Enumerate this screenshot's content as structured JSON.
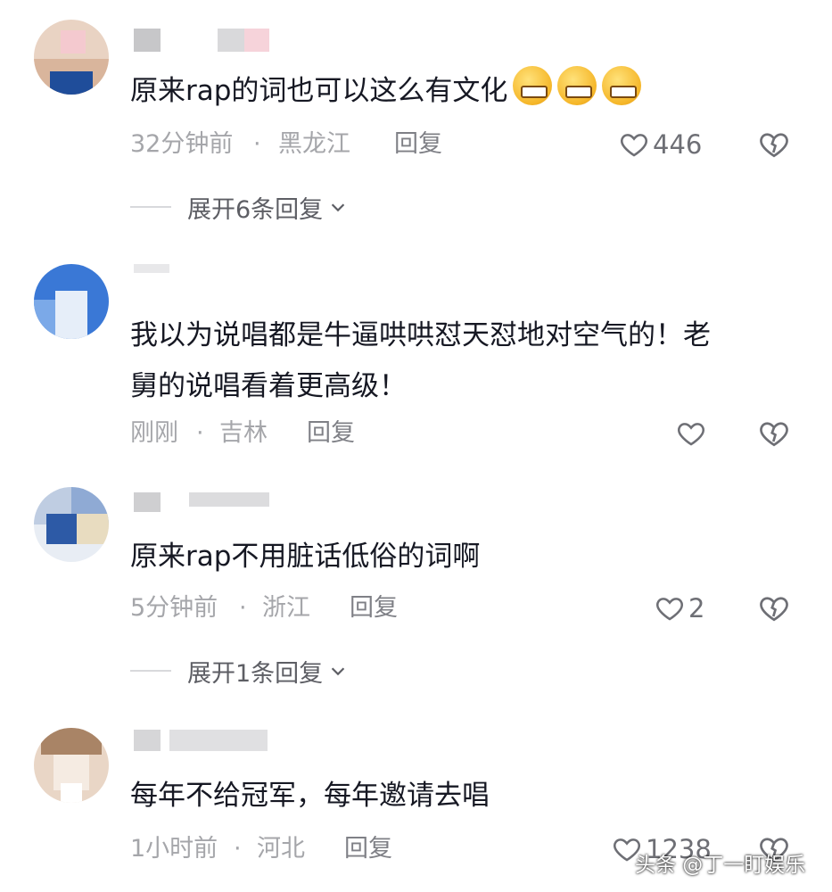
{
  "comments": [
    {
      "text": "原来rap的词也可以这么有文化",
      "emoji": "grinning-sweat-emoji",
      "time": "32分钟前",
      "separator": "·",
      "location": "黑龙江",
      "reply_label": "回复",
      "likes": "446",
      "expand_label": "展开6条回复"
    },
    {
      "text": "我以为说唱都是牛逼哄哄怼天怼地对空气的！老\n舅的说唱看着更高级！",
      "time": "刚刚",
      "separator": "·",
      "location": "吉林",
      "reply_label": "回复",
      "likes": ""
    },
    {
      "text": "原来rap不用脏话低俗的词啊",
      "time": "5分钟前",
      "separator": "·",
      "location": "浙江",
      "reply_label": "回复",
      "likes": "2",
      "expand_label": "展开1条回复"
    },
    {
      "text": "每年不给冠军，每年邀请去唱",
      "time": "1小时前",
      "separator": "·",
      "location": "河北",
      "reply_label": "回复",
      "likes": "1238"
    }
  ],
  "watermark": "头条 @丁一盯娱乐",
  "icons": {
    "like": "heart-outline-icon",
    "dislike": "broken-heart-icon",
    "expand": "chevron-down-icon"
  },
  "colors": {
    "text": "#161823",
    "meta": "#a5a6aa",
    "icon": "#6e6f75"
  }
}
